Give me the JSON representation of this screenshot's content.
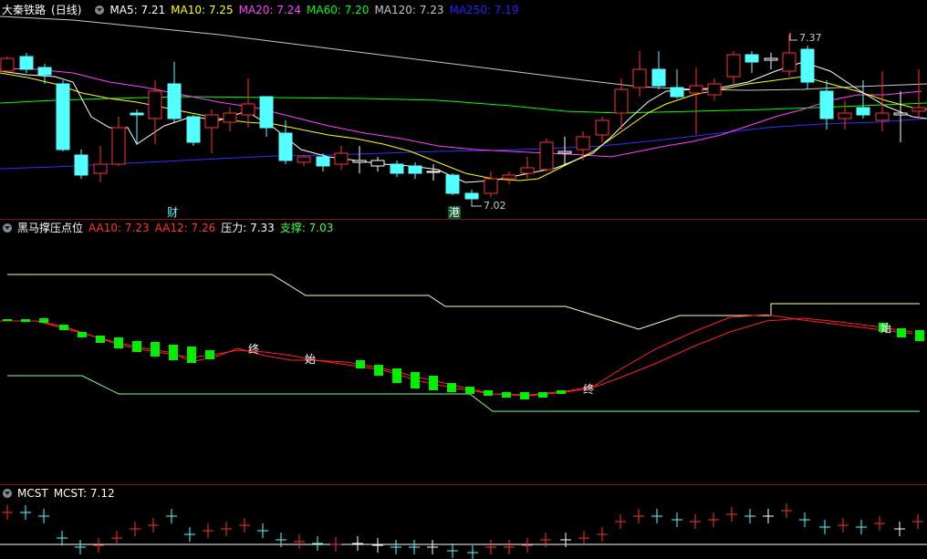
{
  "main": {
    "stock_name": "大秦铁路",
    "period": "(日线)",
    "indicators": [
      {
        "label": "MA5: 7.21",
        "color": "#ffffff"
      },
      {
        "label": "MA10: 7.25",
        "color": "#ffff00"
      },
      {
        "label": "MA20: 7.24",
        "color": "#ff40ff"
      },
      {
        "label": "MA60: 7.20",
        "color": "#00ff00"
      },
      {
        "label": "MA120: 7.23",
        "color": "#c8c8c8"
      },
      {
        "label": "MA250: 7.19",
        "color": "#2020ff"
      }
    ],
    "high_label": "7.37",
    "low_label": "7.02",
    "tag_cai": "财",
    "tag_gang": "港"
  },
  "sub1": {
    "name": "黑马撑压点位",
    "indicators": [
      {
        "label": "AA10: 7.23",
        "color": "#ff3030"
      },
      {
        "label": "AA12: 7.26",
        "color": "#ff3030"
      },
      {
        "label": "压力: 7.33",
        "color": "#ffffff"
      },
      {
        "label": "支撑: 7.03",
        "color": "#40ff40"
      }
    ],
    "markers": [
      "终",
      "始",
      "终",
      "始"
    ]
  },
  "sub2": {
    "name": "MCST",
    "indicators": [
      {
        "label": "MCST: 7.12",
        "color": "#ffffff"
      }
    ]
  },
  "colors": {
    "up": "#ff3030",
    "down": "#54ffff",
    "background": "#000000",
    "divider": "#8b1010"
  }
}
